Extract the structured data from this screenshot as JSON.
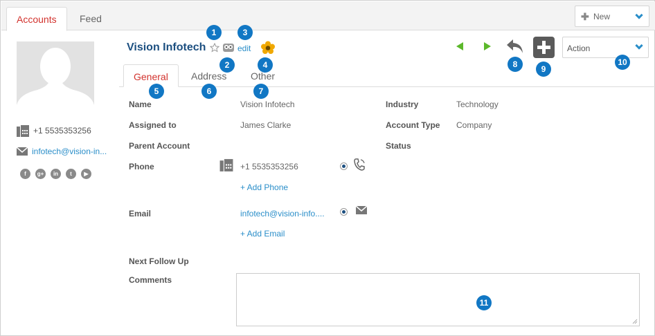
{
  "top_tabs": [
    {
      "label": "Accounts"
    },
    {
      "label": "Feed"
    }
  ],
  "new_button": {
    "label": "New"
  },
  "profile": {
    "phone": "+1 5535353256",
    "email": "infotech@vision-in..."
  },
  "social_icons": [
    "facebook-icon",
    "google-plus-icon",
    "linkedin-icon",
    "twitter-icon",
    "youtube-icon"
  ],
  "record": {
    "title": "Vision Infotech",
    "edit_label": "edit"
  },
  "action_select": {
    "label": "Action"
  },
  "sub_tabs": [
    {
      "label": "General"
    },
    {
      "label": "Address"
    },
    {
      "label": "Other"
    }
  ],
  "fields": {
    "name_label": "Name",
    "name_value": "Vision Infotech",
    "assigned_label": "Assigned to",
    "assigned_value": "James Clarke",
    "parent_label": "Parent Account",
    "phone_label": "Phone",
    "phone_value": "+1 5535353256",
    "add_phone": "+ Add Phone",
    "email_label": "Email",
    "email_value": "infotech@vision-info....",
    "add_email": "+ Add Email",
    "followup_label": "Next Follow Up",
    "comments_label": "Comments",
    "industry_label": "Industry",
    "industry_value": "Technology",
    "account_type_label": "Account Type",
    "account_type_value": "Company",
    "status_label": "Status"
  },
  "callouts": [
    "1",
    "2",
    "3",
    "4",
    "5",
    "6",
    "7",
    "8",
    "9",
    "10",
    "11"
  ],
  "colors": {
    "accent_blue": "#2a8ec9",
    "callout_blue": "#1177c4",
    "active_tab_red": "#d2322d",
    "title_navy": "#1c4f80",
    "arrow_green": "#5cb82b"
  }
}
